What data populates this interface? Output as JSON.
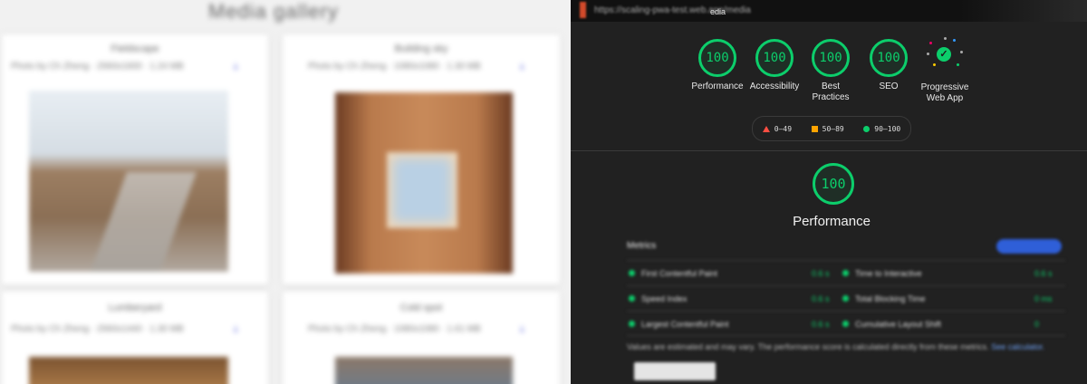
{
  "gallery": {
    "title": "Media gallery",
    "cards": [
      {
        "title": "Fieldscape",
        "meta": "Photo by Ch Zheng · 2560x1600 · 1.24 MB"
      },
      {
        "title": "Building sky",
        "meta": "Photo by Ch Zheng · 1080x1080 · 1.30 MB"
      },
      {
        "title": "Lumberyard",
        "meta": "Photo by Ch Zheng · 2560x1440 · 1.30 MB"
      },
      {
        "title": "Cold spot",
        "meta": "Photo by Ch Zheng · 1080x1080 · 1.61 MB"
      }
    ]
  },
  "report": {
    "url_blur": "https://scaling-pwa-test.web.app/media",
    "url_end": "edia",
    "categories": [
      {
        "score": "100",
        "label": "Performance"
      },
      {
        "score": "100",
        "label": "Accessibility"
      },
      {
        "score": "100",
        "label": "Best Practices"
      },
      {
        "score": "100",
        "label": "SEO"
      },
      {
        "label": "Progressive Web App"
      }
    ],
    "legend": [
      {
        "range": "0–49",
        "color": "#ff4e42"
      },
      {
        "range": "50–89",
        "color": "#ffa400"
      },
      {
        "range": "90–100",
        "color": "#0cce6b"
      }
    ],
    "performance": {
      "score": "100",
      "title": "Performance",
      "metrics_heading": "Metrics",
      "metrics": [
        {
          "name": "First Contentful Paint",
          "value": "0.6 s"
        },
        {
          "name": "Time to Interactive",
          "value": "0.6 s"
        },
        {
          "name": "Speed Index",
          "value": "0.6 s"
        },
        {
          "name": "Total Blocking Time",
          "value": "0 ms"
        },
        {
          "name": "Largest Contentful Paint",
          "value": "0.6 s"
        },
        {
          "name": "Cumulative Layout Shift",
          "value": "0"
        }
      ],
      "note": "Values are estimated and may vary. The performance score is calculated directly from these metrics.",
      "note_link": "See calculator."
    }
  },
  "colors": {
    "pass": "#0cce6b",
    "average": "#ffa400",
    "fail": "#ff4e42"
  }
}
